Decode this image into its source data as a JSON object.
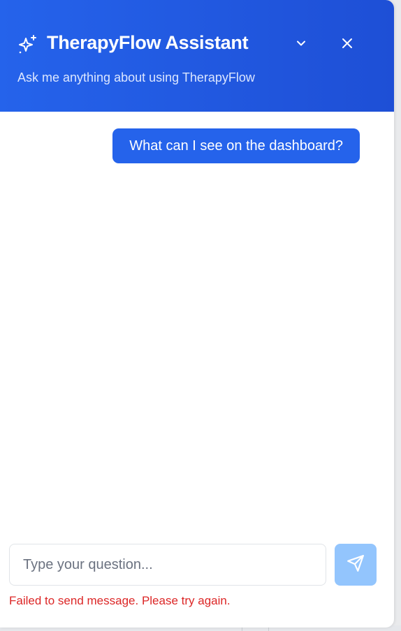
{
  "header": {
    "title": "TherapyFlow Assistant",
    "subtitle": "Ask me anything about using TherapyFlow",
    "icons": {
      "sparkle": "sparkle-icon",
      "collapse": "chevron-down-icon",
      "close": "close-icon"
    }
  },
  "messages": [
    {
      "role": "user",
      "text": "What can I see on the dashboard?"
    }
  ],
  "composer": {
    "placeholder": "Type your question...",
    "value": "",
    "send_icon": "send-icon"
  },
  "error": {
    "text": "Failed to send message. Please try again."
  },
  "colors": {
    "accent": "#2563eb",
    "send_button_disabled": "#93c5fd",
    "error": "#dc2626"
  }
}
